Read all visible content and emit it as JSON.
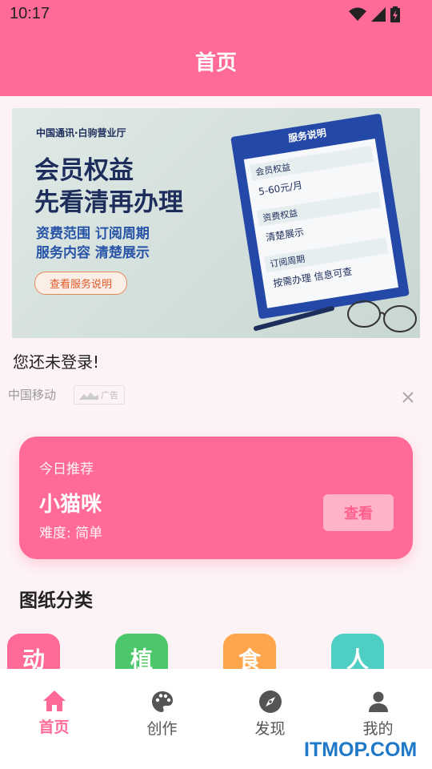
{
  "status_bar": {
    "time": "10:17"
  },
  "app_bar": {
    "title": "首页"
  },
  "banner": {
    "tag": "中国通讯·白驹营业厅",
    "headline_line1": "会员权益",
    "headline_line2": "先看清再办理",
    "sub_line1": "资费范围 订阅周期",
    "sub_line2": "服务内容 清楚展示",
    "cta": "查看服务说明",
    "doc_title": "服务说明",
    "doc_rows": [
      {
        "label": "会员权益",
        "value": "5-60元/月"
      },
      {
        "label": "资费权益",
        "value": "清楚展示"
      },
      {
        "label": "订阅周期",
        "value": "按需办理  信息可查"
      }
    ]
  },
  "login_prompt": "您还未登录!",
  "ad": {
    "source": "中国移动",
    "badge": "广告"
  },
  "recommend": {
    "label": "今日推荐",
    "title": "小猫咪",
    "difficulty": "难度: 简单",
    "button": "查看"
  },
  "categories_title": "图纸分类",
  "categories": [
    {
      "label": "动",
      "color": "#ff6b96"
    },
    {
      "label": "植",
      "color": "#4cc86a"
    },
    {
      "label": "食",
      "color": "#ffa64d"
    },
    {
      "label": "人",
      "color": "#4fcfc4"
    }
  ],
  "nav": [
    {
      "label": "首页",
      "icon": "home-icon"
    },
    {
      "label": "创作",
      "icon": "palette-icon"
    },
    {
      "label": "发现",
      "icon": "compass-icon"
    },
    {
      "label": "我的",
      "icon": "person-icon"
    }
  ],
  "watermark": "ITMOP.COM",
  "colors": {
    "accent": "#ff6b96",
    "accent_light": "#ffb3c8",
    "background": "#fdf2f5"
  }
}
